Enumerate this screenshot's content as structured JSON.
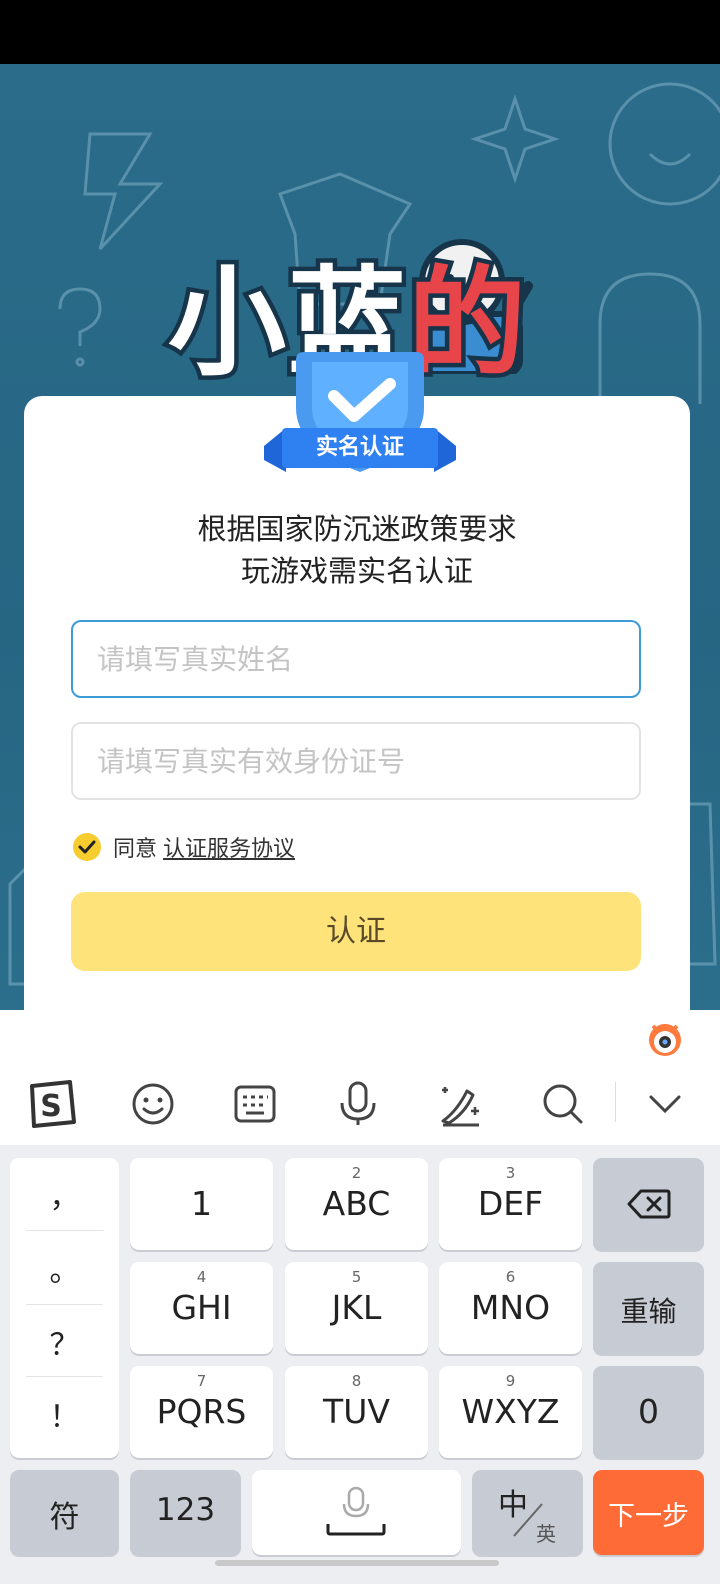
{
  "dialog": {
    "badge_label": "实名认证",
    "title_line1": "根据国家防沉迷政策要求",
    "title_line2": "玩游戏需实名认证",
    "name_placeholder": "请填写真实姓名",
    "id_placeholder": "请填写真实有效身份证号",
    "agree_text": "同意",
    "agreement_link": "认证服务协议",
    "submit_label": "认证"
  },
  "background": {
    "logo_chars": [
      "小",
      "蓝",
      "的"
    ]
  },
  "keyboard": {
    "toolbar_icons": [
      "sogou-logo-icon",
      "emoji-icon",
      "keyboard-icon",
      "microphone-icon",
      "handwriting-icon",
      "search-icon",
      "collapse-chevron-icon"
    ],
    "punctuation": [
      "，",
      "。",
      "？",
      "！"
    ],
    "keys": [
      {
        "main": "1",
        "sub": ""
      },
      {
        "main": "ABC",
        "sub": "2"
      },
      {
        "main": "DEF",
        "sub": "3"
      },
      {
        "main": "GHI",
        "sub": "4"
      },
      {
        "main": "JKL",
        "sub": "5"
      },
      {
        "main": "MNO",
        "sub": "6"
      },
      {
        "main": "PQRS",
        "sub": "7"
      },
      {
        "main": "TUV",
        "sub": "8"
      },
      {
        "main": "WXYZ",
        "sub": "9"
      }
    ],
    "reinput": "重输",
    "zero": "0",
    "symbols": "符",
    "numbers": "123",
    "lang_zh": "中",
    "lang_en": "英",
    "next": "下一步"
  }
}
